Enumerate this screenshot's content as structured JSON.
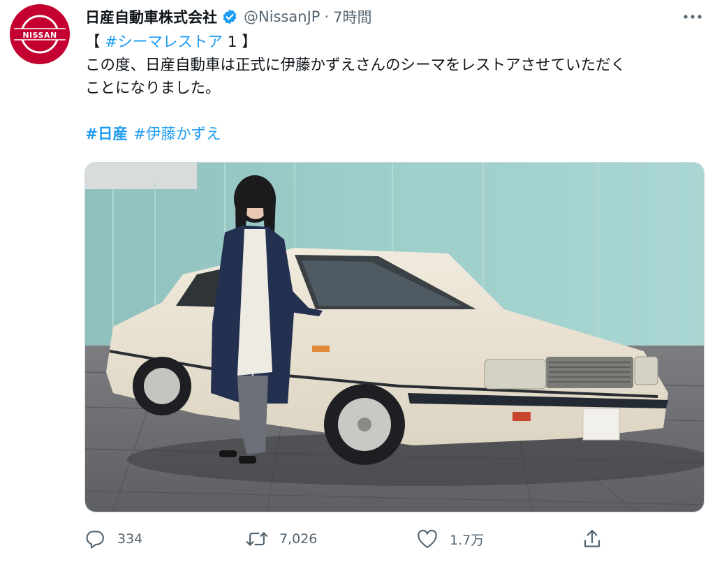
{
  "tweet": {
    "avatar_text": "NISSAN",
    "display_name": "日産自動車株式会社",
    "handle": "@NissanJP",
    "separator": "·",
    "time": "7時間",
    "text_prefix": "【 ",
    "hashtag_main": "#シーマレストア",
    "text_suffix": " 1 】",
    "line2": "この度、日産自動車は正式に伊藤かずえさんのシーマをレストアさせていただく",
    "line3": "ことになりました。",
    "hashtags": [
      "#日産",
      "#伊藤かずえ"
    ]
  },
  "actions": {
    "reply_count": "334",
    "retweet_count": "7,026",
    "like_count": "1.7万"
  },
  "icons": {
    "verified": "verified-badge-icon",
    "more": "more-options-icon",
    "reply": "reply-icon",
    "retweet": "retweet-icon",
    "like": "like-icon",
    "share": "share-icon"
  },
  "colors": {
    "brand_red": "#c3002f",
    "link_blue": "#1d9bf0",
    "muted_gray": "#536471",
    "text_black": "#0f1419"
  }
}
